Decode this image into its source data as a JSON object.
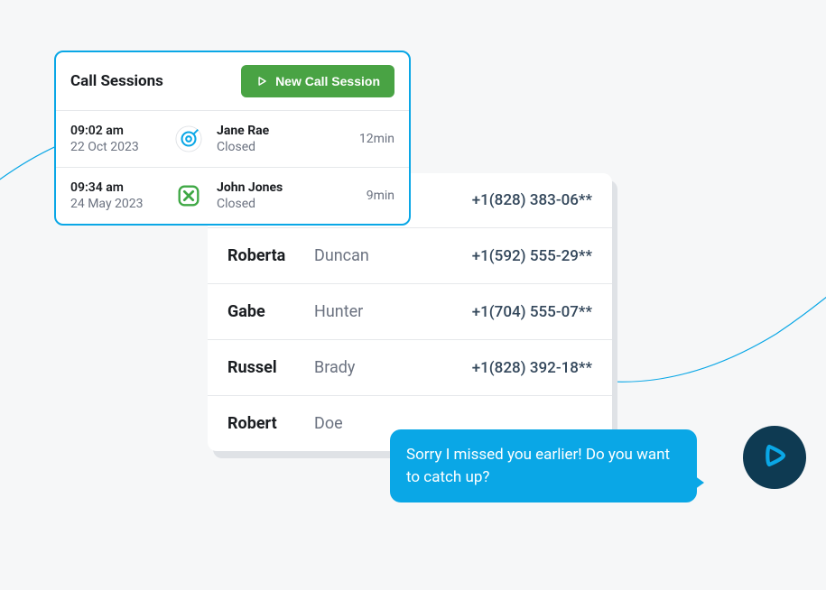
{
  "call_sessions": {
    "title": "Call Sessions",
    "new_button_label": "New Call Session",
    "rows": [
      {
        "time": "09:02 am",
        "date": "22 Oct 2023",
        "name": "Jane Rae",
        "status": "Closed",
        "duration": "12min",
        "icon": "target-icon"
      },
      {
        "time": "09:34 am",
        "date": "24 May 2023",
        "name": "John Jones",
        "status": "Closed",
        "duration": "9min",
        "icon": "x-box-icon"
      }
    ]
  },
  "contacts": {
    "rows": [
      {
        "first": "",
        "last": "",
        "phone": "+1(828) 383-06**"
      },
      {
        "first": "Roberta",
        "last": "Duncan",
        "phone": "+1(592) 555-29**"
      },
      {
        "first": "Gabe",
        "last": "Hunter",
        "phone": "+1(704) 555-07**"
      },
      {
        "first": "Russel",
        "last": "Brady",
        "phone": "+1(828) 392-18**"
      },
      {
        "first": "Robert",
        "last": "Doe",
        "phone": ""
      }
    ]
  },
  "message_bubble": {
    "text": "Sorry I missed you earlier! Do you want to catch up?"
  },
  "colors": {
    "accent_blue": "#0aa7e6",
    "green": "#49a344",
    "dark_navy": "#0e3a52"
  }
}
